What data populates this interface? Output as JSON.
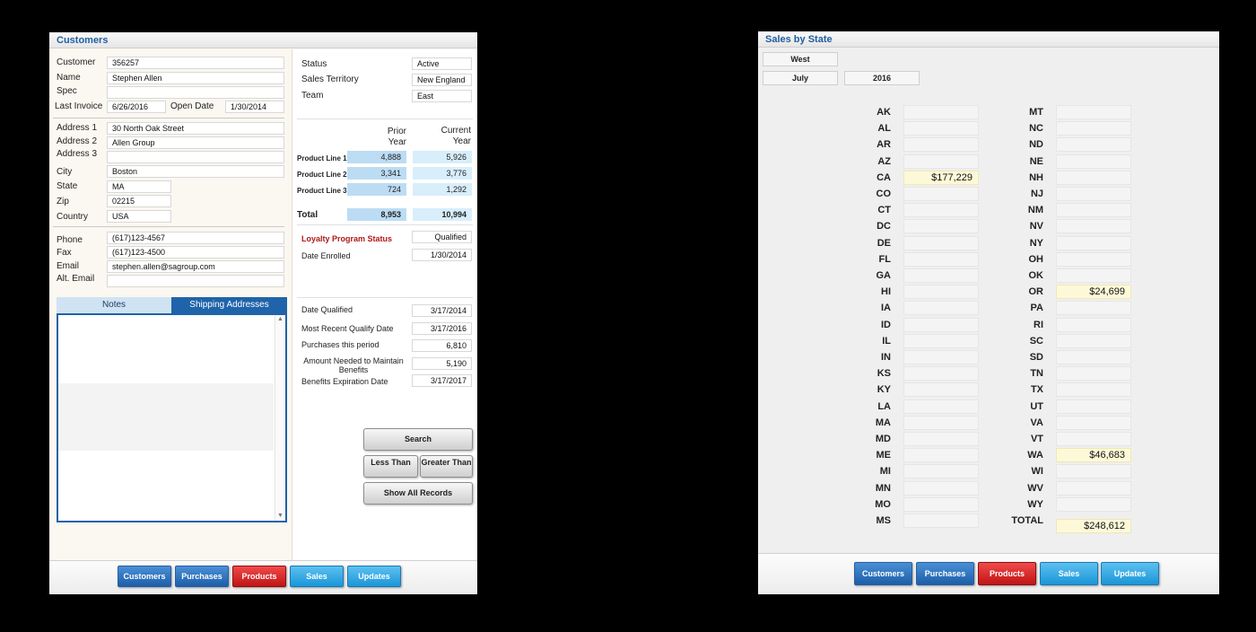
{
  "customers": {
    "title": "Customers",
    "fields": {
      "customer_label": "Customer",
      "customer": "356257",
      "name_label": "Name",
      "name": "Stephen Allen",
      "spec_label": "Spec",
      "spec": "",
      "last_invoice_label": "Last Invoice",
      "last_invoice": "6/26/2016",
      "open_date_label": "Open Date",
      "open_date": "1/30/2014",
      "address1_label": "Address 1",
      "address1": "30 North Oak Street",
      "address2_label": "Address 2",
      "address2": "Allen Group",
      "address3_label": "Address 3",
      "address3": "",
      "city_label": "City",
      "city": "Boston",
      "state_label": "State",
      "state": "MA",
      "zip_label": "Zip",
      "zip": "02215",
      "country_label": "Country",
      "country": "USA",
      "phone_label": "Phone",
      "phone": "(617)123-4567",
      "fax_label": "Fax",
      "fax": "(617)123-4500",
      "email_label": "Email",
      "email": "stephen.allen@sagroup.com",
      "alt_email_label": "Alt. Email",
      "alt_email": ""
    },
    "status": {
      "status_label": "Status",
      "status": "Active",
      "territory_label": "Sales Territory",
      "territory": "New England",
      "team_label": "Team",
      "team": "East"
    },
    "product_lines": {
      "prior_header": "Prior Year",
      "current_header": "Current Year",
      "rows": [
        {
          "label": "Product Line 1",
          "prior": "4,888",
          "current": "5,926"
        },
        {
          "label": "Product Line 2",
          "prior": "3,341",
          "current": "3,776"
        },
        {
          "label": "Product Line 3",
          "prior": "724",
          "current": "1,292"
        }
      ],
      "total_label": "Total",
      "total_prior": "8,953",
      "total_current": "10,994"
    },
    "loyalty": {
      "status_label": "Loyalty Program Status",
      "status": "Qualified",
      "enrolled_label": "Date Enrolled",
      "enrolled": "1/30/2014",
      "qualified_label": "Date Qualified",
      "qualified": "3/17/2014",
      "recent_label": "Most Recent Qualify Date",
      "recent": "3/17/2016",
      "purchases_label": "Purchases this period",
      "purchases": "6,810",
      "needed_label": "Amount Needed  to Maintain Benefits",
      "needed": "5,190",
      "expiration_label": "Benefits Expiration Date",
      "expiration": "3/17/2017"
    },
    "tabs": {
      "notes": "Notes",
      "shipping": "Shipping Addresses"
    },
    "actions": {
      "search": "Search",
      "less_than": "Less Than",
      "greater_than": "Greater Than",
      "show_all": "Show All Records"
    }
  },
  "sales": {
    "title": "Sales by State",
    "region": "West",
    "month": "July",
    "year": "2016",
    "left_states": [
      {
        "code": "AK",
        "value": ""
      },
      {
        "code": "AL",
        "value": ""
      },
      {
        "code": "AR",
        "value": ""
      },
      {
        "code": "AZ",
        "value": ""
      },
      {
        "code": "CA",
        "value": "$177,229"
      },
      {
        "code": "CO",
        "value": ""
      },
      {
        "code": "CT",
        "value": ""
      },
      {
        "code": "DC",
        "value": ""
      },
      {
        "code": "DE",
        "value": ""
      },
      {
        "code": "FL",
        "value": ""
      },
      {
        "code": "GA",
        "value": ""
      },
      {
        "code": "HI",
        "value": ""
      },
      {
        "code": "IA",
        "value": ""
      },
      {
        "code": "ID",
        "value": ""
      },
      {
        "code": "IL",
        "value": ""
      },
      {
        "code": "IN",
        "value": ""
      },
      {
        "code": "KS",
        "value": ""
      },
      {
        "code": "KY",
        "value": ""
      },
      {
        "code": "LA",
        "value": ""
      },
      {
        "code": "MA",
        "value": ""
      },
      {
        "code": "MD",
        "value": ""
      },
      {
        "code": "ME",
        "value": ""
      },
      {
        "code": "MI",
        "value": ""
      },
      {
        "code": "MN",
        "value": ""
      },
      {
        "code": "MO",
        "value": ""
      },
      {
        "code": "MS",
        "value": ""
      }
    ],
    "right_states": [
      {
        "code": "MT",
        "value": ""
      },
      {
        "code": "NC",
        "value": ""
      },
      {
        "code": "ND",
        "value": ""
      },
      {
        "code": "NE",
        "value": ""
      },
      {
        "code": "NH",
        "value": ""
      },
      {
        "code": "NJ",
        "value": ""
      },
      {
        "code": "NM",
        "value": ""
      },
      {
        "code": "NV",
        "value": ""
      },
      {
        "code": "NY",
        "value": ""
      },
      {
        "code": "OH",
        "value": ""
      },
      {
        "code": "OK",
        "value": ""
      },
      {
        "code": "OR",
        "value": "$24,699"
      },
      {
        "code": "PA",
        "value": ""
      },
      {
        "code": "RI",
        "value": ""
      },
      {
        "code": "SC",
        "value": ""
      },
      {
        "code": "SD",
        "value": ""
      },
      {
        "code": "TN",
        "value": ""
      },
      {
        "code": "TX",
        "value": ""
      },
      {
        "code": "UT",
        "value": ""
      },
      {
        "code": "VA",
        "value": ""
      },
      {
        "code": "VT",
        "value": ""
      },
      {
        "code": "WA",
        "value": "$46,683"
      },
      {
        "code": "WI",
        "value": ""
      },
      {
        "code": "WV",
        "value": ""
      },
      {
        "code": "WY",
        "value": ""
      },
      {
        "code": "TOTAL",
        "value": "$248,612"
      }
    ]
  },
  "nav": [
    "Customers",
    "Purchases",
    "Products",
    "Sales",
    "Updates"
  ],
  "colors": {
    "accent": "#1f63aa",
    "products": "#d41e1e",
    "light_blue": "#1a96d8"
  }
}
